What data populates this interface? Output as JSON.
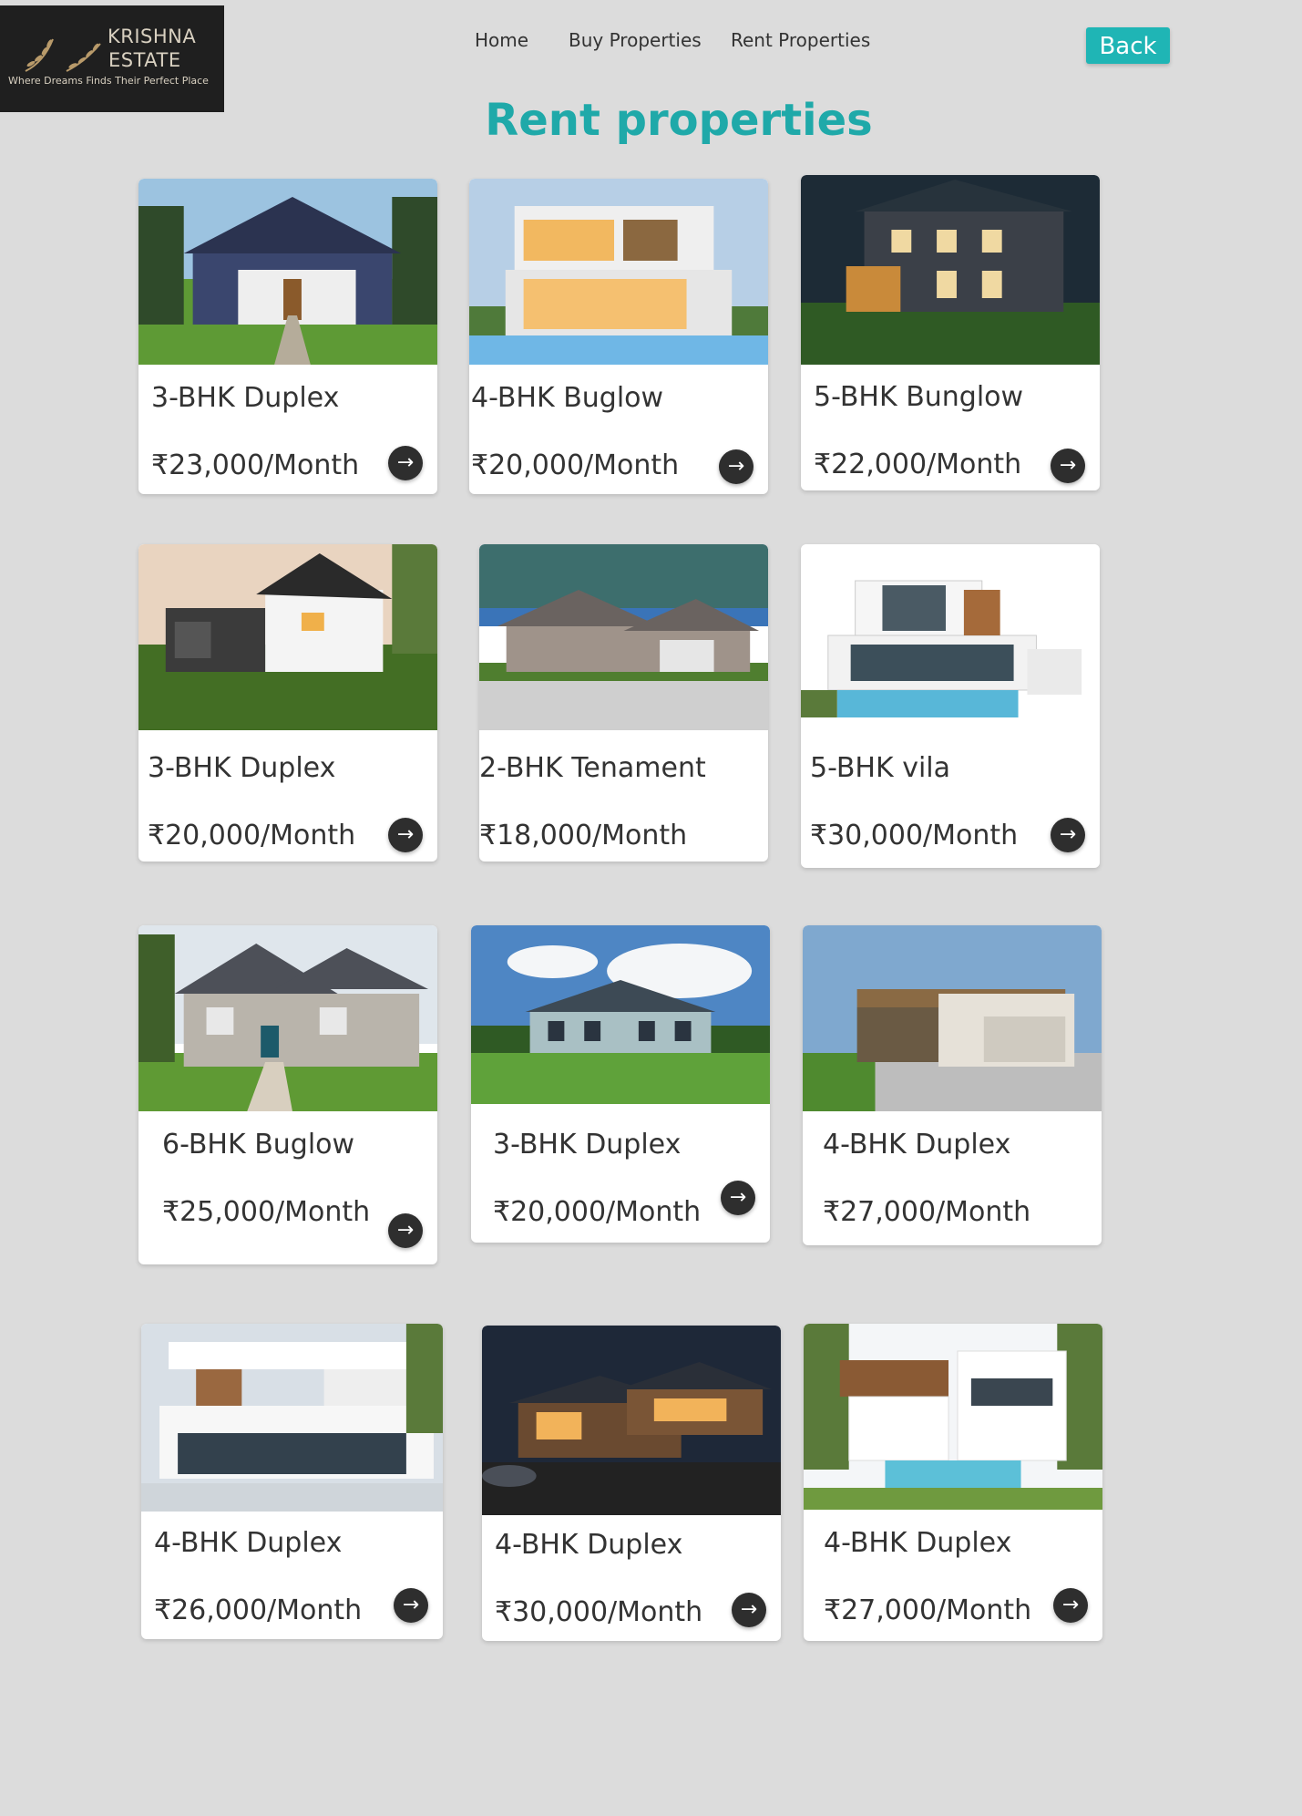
{
  "brand": {
    "line1": "KRISHNA",
    "line2": "ESTATE",
    "tagline": "Where Dreams Finds Their Perfect Place"
  },
  "nav": {
    "home": "Home",
    "buy": "Buy Properties",
    "rent": "Rent Properties"
  },
  "back_label": "Back",
  "page_title": "Rent properties",
  "arrow_glyph": "→",
  "colors": {
    "accent": "#1fb5b5",
    "title": "#1fa9a9",
    "background": "#dcdcdc"
  },
  "properties": [
    {
      "title": "3-BHK Duplex",
      "price": "₹23,000/Month"
    },
    {
      "title": "4-BHK Buglow",
      "price": "₹20,000/Month"
    },
    {
      "title": "5-BHK Bunglow",
      "price": "₹22,000/Month"
    },
    {
      "title": "3-BHK Duplex",
      "price": "₹20,000/Month"
    },
    {
      "title": "2-BHK Tenament",
      "price": "₹18,000/Month"
    },
    {
      "title": "5-BHK vila",
      "price": "₹30,000/Month"
    },
    {
      "title": "6-BHK Buglow",
      "price": "₹25,000/Month"
    },
    {
      "title": "3-BHK Duplex",
      "price": "₹20,000/Month"
    },
    {
      "title": "4-BHK Duplex",
      "price": "₹27,000/Month"
    },
    {
      "title": "4-BHK Duplex",
      "price": "₹26,000/Month"
    },
    {
      "title": "4-BHK Duplex",
      "price": "₹30,000/Month"
    },
    {
      "title": "4-BHK Duplex",
      "price": "₹27,000/Month"
    }
  ]
}
